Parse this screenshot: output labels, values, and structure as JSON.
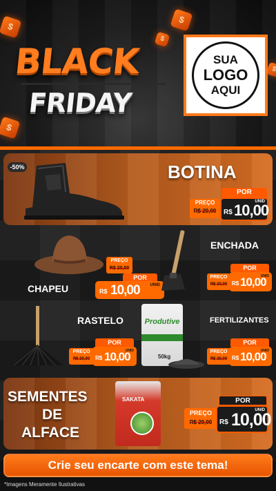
{
  "header": {
    "title_line1": "BLACK",
    "title_line2": "FRIDAY",
    "logo_line1": "SUA",
    "logo_line2": "LOGO",
    "logo_line3": "AQUI",
    "cube_glyph": "$"
  },
  "products": {
    "botina": {
      "name": "BOTINA",
      "discount_badge": "-50%",
      "por": "POR",
      "preco_label": "PREÇO",
      "old_price": "R$ 20,00",
      "currency": "R$",
      "price": "10,00",
      "unit": "UNID"
    },
    "chapeu": {
      "name": "CHAPEU",
      "por": "POR",
      "preco_label": "PREÇO",
      "old_price": "R$ 20,00",
      "currency": "R$",
      "price": "10,00",
      "unit": "UNID"
    },
    "enchada": {
      "name": "ENCHADA",
      "por": "POR",
      "preco_label": "PREÇO",
      "old_price": "R$ 20,00",
      "currency": "R$",
      "price": "10,00",
      "unit": "UNID"
    },
    "rastelo": {
      "name": "RASTELO",
      "por": "POR",
      "preco_label": "PREÇO",
      "old_price": "R$ 20,00",
      "currency": "R$",
      "price": "10,00",
      "unit": "UNID"
    },
    "fertilizantes": {
      "name": "FERTILIZANTES",
      "package_brand": "Produtive",
      "package_weight": "50kg",
      "por": "POR",
      "preco_label": "PREÇO",
      "old_price": "R$ 20,00",
      "currency": "R$",
      "price": "10,00",
      "unit": "UNID"
    },
    "sementes": {
      "name_line1": "SEMENTES",
      "name_line2": "DE",
      "name_line3": "ALFACE",
      "package_brand": "SAKATA",
      "por": "POR",
      "preco_label": "PREÇO",
      "old_price": "R$ 20,00",
      "currency": "R$",
      "price": "10,00",
      "unit": "UNID"
    }
  },
  "cta": {
    "text": "Crie seu encarte com este tema!"
  },
  "disclaimer": {
    "text": "*Imagens Meramente Ilustrativas"
  },
  "colors": {
    "accent": "#ff6a00",
    "dark": "#1b1b1b",
    "brown": "#b25a1e"
  }
}
